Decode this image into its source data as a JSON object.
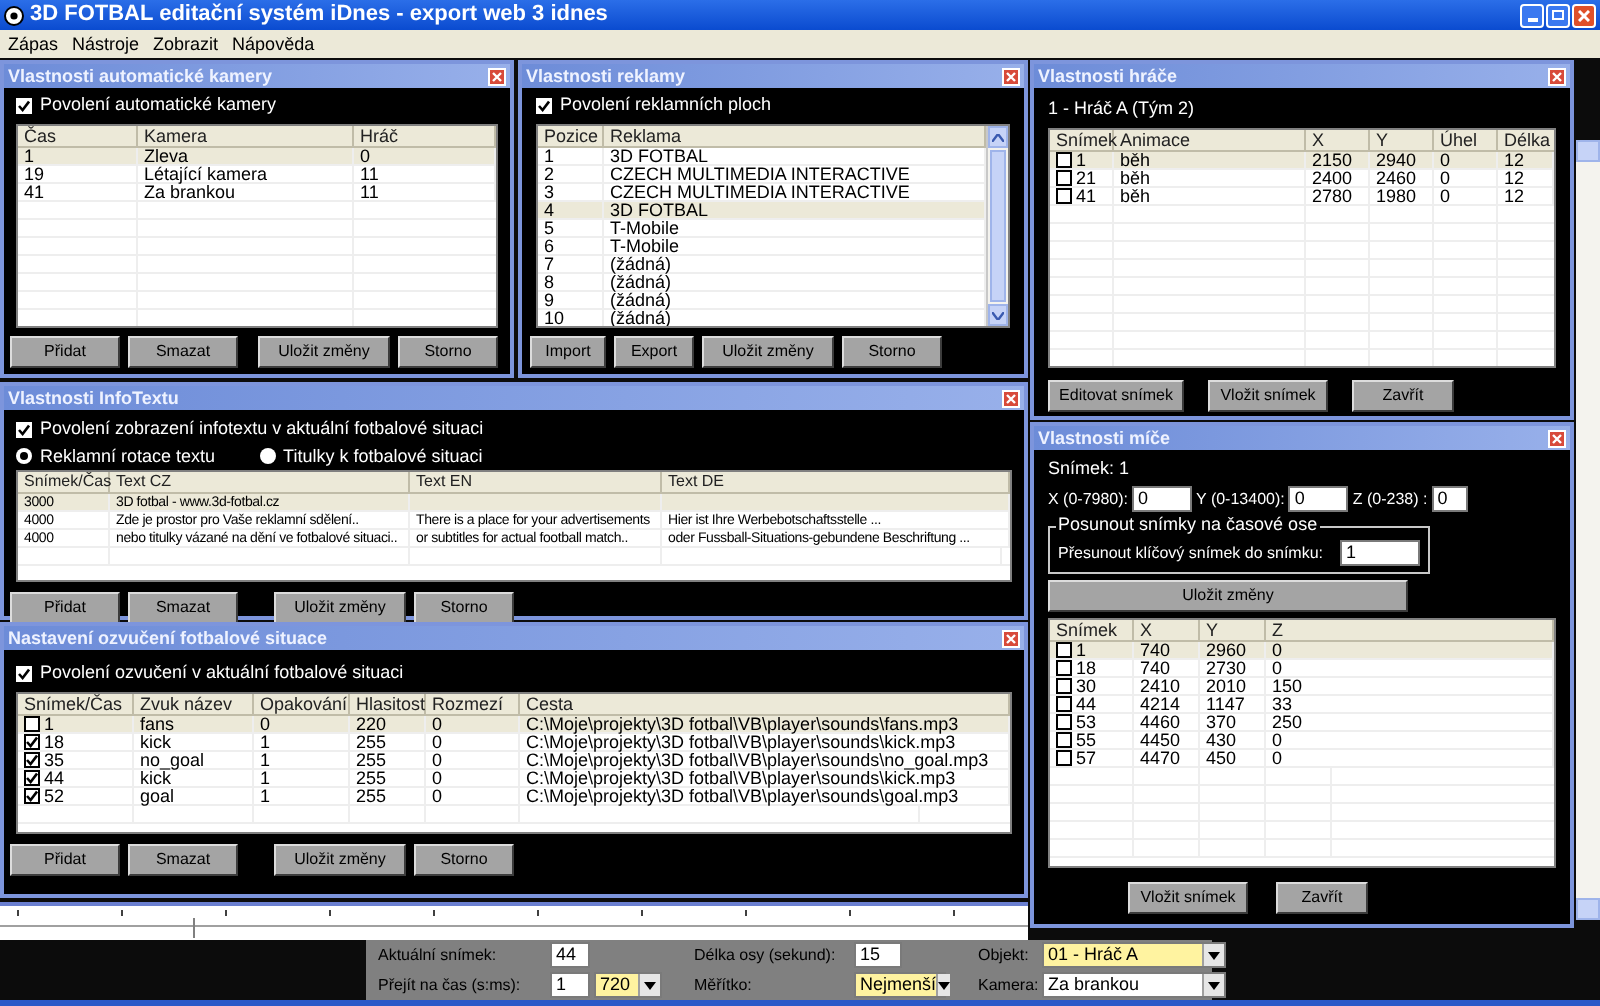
{
  "window": {
    "title": "3D FOTBAL editační systém iDnes - export web 3 idnes"
  },
  "menu": [
    "Zápas",
    "Nástroje",
    "Zobrazit",
    "Nápověda"
  ],
  "camera": {
    "title": "Vlastnosti automatické kamery",
    "enable": {
      "label": "Povolení automatické kamery",
      "checked": true
    },
    "table": {
      "columns": [
        "Čas",
        "Kamera",
        "Hráč"
      ],
      "rows": [
        {
          "cells": [
            "1",
            "Zleva",
            "0"
          ],
          "selected": true
        },
        {
          "cells": [
            "19",
            "Létající kamera",
            "11"
          ],
          "selected": false
        },
        {
          "cells": [
            "41",
            "Za brankou",
            "11"
          ],
          "selected": false
        }
      ]
    },
    "buttons": [
      "Přidat",
      "Smazat",
      "Uložit změny",
      "Storno"
    ]
  },
  "ads": {
    "title": "Vlastnosti reklamy",
    "enable": {
      "label": "Povolení reklamních ploch",
      "checked": true
    },
    "table": {
      "columns": [
        "Pozice",
        "Reklama"
      ],
      "rows": [
        {
          "cells": [
            "1",
            "3D FOTBAL"
          ],
          "selected": false
        },
        {
          "cells": [
            "2",
            "CZECH MULTIMEDIA INTERACTIVE"
          ],
          "selected": false
        },
        {
          "cells": [
            "3",
            "CZECH MULTIMEDIA INTERACTIVE"
          ],
          "selected": false
        },
        {
          "cells": [
            "4",
            "3D FOTBAL"
          ],
          "selected": true
        },
        {
          "cells": [
            "5",
            "T-Mobile"
          ],
          "selected": false
        },
        {
          "cells": [
            "6",
            "T-Mobile"
          ],
          "selected": false
        },
        {
          "cells": [
            "7",
            "(žádná)"
          ],
          "selected": false
        },
        {
          "cells": [
            "8",
            "(žádná)"
          ],
          "selected": false
        },
        {
          "cells": [
            "9",
            "(žádná)"
          ],
          "selected": false
        },
        {
          "cells": [
            "10",
            "(žádná)"
          ],
          "selected": false
        }
      ]
    },
    "buttons": [
      "Import",
      "Export",
      "Uložit změny",
      "Storno"
    ]
  },
  "player": {
    "title": "Vlastnosti hráče",
    "subtitle": "1 - Hráč A (Tým 2)",
    "table": {
      "columns": [
        "Snímek",
        "Animace",
        "X",
        "Y",
        "Úhel",
        "Délka"
      ],
      "rows": [
        {
          "cells": [
            "1",
            "běh",
            "2150",
            "2940",
            "0",
            "12"
          ],
          "checked": false,
          "selected": true
        },
        {
          "cells": [
            "21",
            "běh",
            "2400",
            "2460",
            "0",
            "12"
          ],
          "checked": false,
          "selected": false
        },
        {
          "cells": [
            "41",
            "běh",
            "2780",
            "1980",
            "0",
            "12"
          ],
          "checked": false,
          "selected": false
        }
      ]
    },
    "buttons": [
      "Editovat snímek",
      "Vložit snímek",
      "Zavřít"
    ]
  },
  "infotext": {
    "title": "Vlastnosti InfoTextu",
    "enable": {
      "label": "Povolení zobrazení infotextu v aktuální fotbalové situaci",
      "checked": true
    },
    "radios": [
      {
        "label": "Reklamní rotace textu",
        "selected": true
      },
      {
        "label": "Titulky k fotbalové situaci",
        "selected": false
      }
    ],
    "table": {
      "columns": [
        "Snímek/Čas",
        "Text CZ",
        "Text EN",
        "Text DE"
      ],
      "rows": [
        {
          "cells": [
            "3000",
            "3D fotbal - www.3d-fotbal.cz",
            "",
            ""
          ],
          "selected": true
        },
        {
          "cells": [
            "4000",
            "Zde je prostor pro Vaše reklamní sdělení..",
            "There is a place for your advertisements",
            "Hier ist Ihre Werbebotschaftsstelle ..."
          ],
          "selected": false
        },
        {
          "cells": [
            "4000",
            "nebo titulky vázané na dění ve fotbalové situaci..",
            "or  subtitles for actual football match..",
            "oder Fussball-Situations-gebundene Beschriftung ..."
          ],
          "selected": false
        }
      ]
    },
    "buttons": [
      "Přidat",
      "Smazat",
      "Uložit změny",
      "Storno"
    ]
  },
  "sound": {
    "title": "Nastavení ozvučení fotbalové situace",
    "enable": {
      "label": "Povolení ozvučení v aktuální fotbalové situaci",
      "checked": true
    },
    "table": {
      "columns": [
        "Snímek/Čas",
        "Zvuk název",
        "Opakování",
        "Hlasitost",
        "Rozmezí",
        "Cesta"
      ],
      "rows": [
        {
          "cells": [
            "1",
            "fans",
            "0",
            "220",
            "0",
            "C:\\Moje\\projekty\\3D fotbal\\VB\\player\\sounds\\fans.mp3"
          ],
          "checked": false,
          "selected": true
        },
        {
          "cells": [
            "18",
            "kick",
            "1",
            "255",
            "0",
            "C:\\Moje\\projekty\\3D fotbal\\VB\\player\\sounds\\kick.mp3"
          ],
          "checked": true,
          "selected": false
        },
        {
          "cells": [
            "35",
            "no_goal",
            "1",
            "255",
            "0",
            "C:\\Moje\\projekty\\3D fotbal\\VB\\player\\sounds\\no_goal.mp3"
          ],
          "checked": true,
          "selected": false
        },
        {
          "cells": [
            "44",
            "kick",
            "1",
            "255",
            "0",
            "C:\\Moje\\projekty\\3D fotbal\\VB\\player\\sounds\\kick.mp3"
          ],
          "checked": true,
          "selected": false
        },
        {
          "cells": [
            "52",
            "goal",
            "1",
            "255",
            "0",
            "C:\\Moje\\projekty\\3D fotbal\\VB\\player\\sounds\\goal.mp3"
          ],
          "checked": true,
          "selected": false
        }
      ]
    },
    "buttons": [
      "Přidat",
      "Smazat",
      "Uložit změny",
      "Storno"
    ]
  },
  "ball": {
    "title": "Vlastnosti míče",
    "frame": "Snímek: 1",
    "coords": [
      {
        "label": "X (0-7980):",
        "value": "0"
      },
      {
        "label": "Y (0-13400):",
        "value": "0"
      },
      {
        "label": "Z  (0-238) :",
        "value": "0"
      }
    ],
    "shift": {
      "title": "Posunout snímky na časové ose",
      "label": "Přesunout klíčový snímek do snímku:",
      "value": "1"
    },
    "save": "Uložit změny",
    "table": {
      "columns": [
        "Snímek",
        "X",
        "Y",
        "Z"
      ],
      "rows": [
        {
          "cells": [
            "1",
            "740",
            "2960",
            "0"
          ],
          "checked": false,
          "selected": true
        },
        {
          "cells": [
            "18",
            "740",
            "2730",
            "0"
          ],
          "checked": false,
          "selected": false
        },
        {
          "cells": [
            "30",
            "2410",
            "2010",
            "150"
          ],
          "checked": false,
          "selected": false
        },
        {
          "cells": [
            "44",
            "4214",
            "1147",
            "33"
          ],
          "checked": false,
          "selected": false
        },
        {
          "cells": [
            "53",
            "4460",
            "370",
            "250"
          ],
          "checked": false,
          "selected": false
        },
        {
          "cells": [
            "55",
            "4450",
            "430",
            "0"
          ],
          "checked": false,
          "selected": false
        },
        {
          "cells": [
            "57",
            "4470",
            "450",
            "0"
          ],
          "checked": false,
          "selected": false
        }
      ]
    },
    "buttons": [
      "Vložit snímek",
      "Zavřít"
    ]
  },
  "status": {
    "current_frame": {
      "label": "Aktuální snímek:",
      "value": "44"
    },
    "goto_time": {
      "label": "Přejít na čas (s:ms):",
      "value": "1",
      "ms": "720"
    },
    "axis_length": {
      "label": "Délka osy (sekund):",
      "value": "15"
    },
    "scale": {
      "label": "Měřítko:",
      "value": "Nejmenší"
    },
    "object": {
      "label": "Objekt:",
      "value": "01 - Hráč A"
    },
    "camera": {
      "label": "Kamera:",
      "value": "Za brankou"
    }
  }
}
